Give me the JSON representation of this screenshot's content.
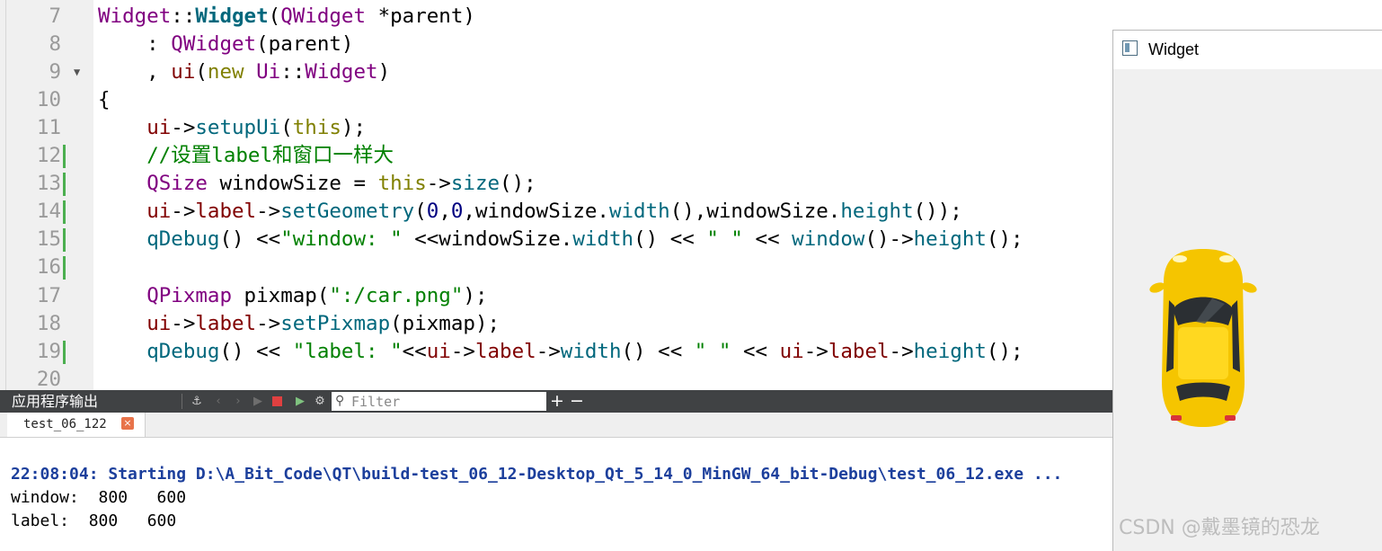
{
  "editor": {
    "lines": [
      {
        "n": "7",
        "modified": false,
        "fold": false,
        "tokens": [
          [
            "Widget",
            "cls"
          ],
          [
            "::",
            ""
          ],
          [
            "Widget",
            "fnb"
          ],
          [
            "(",
            ""
          ],
          [
            "QWidget",
            "cls"
          ],
          [
            " *parent)",
            ""
          ]
        ]
      },
      {
        "n": "8",
        "modified": false,
        "fold": false,
        "tokens": [
          [
            "    : ",
            ""
          ],
          [
            "QWidget",
            "cls"
          ],
          [
            "(parent)",
            ""
          ]
        ]
      },
      {
        "n": "9",
        "modified": false,
        "fold": true,
        "tokens": [
          [
            "    , ",
            ""
          ],
          [
            "ui",
            "mem"
          ],
          [
            "(",
            ""
          ],
          [
            "new",
            "kw"
          ],
          [
            " ",
            ""
          ],
          [
            "Ui",
            "cls"
          ],
          [
            "::",
            ""
          ],
          [
            "Widget",
            "cls"
          ],
          [
            ")",
            ""
          ]
        ]
      },
      {
        "n": "10",
        "modified": false,
        "fold": false,
        "tokens": [
          [
            "{",
            ""
          ]
        ]
      },
      {
        "n": "11",
        "modified": false,
        "fold": false,
        "tokens": [
          [
            "    ",
            ""
          ],
          [
            "ui",
            "mem"
          ],
          [
            "->",
            ""
          ],
          [
            "setupUi",
            "fn"
          ],
          [
            "(",
            ""
          ],
          [
            "this",
            "kw"
          ],
          [
            ");",
            ""
          ]
        ]
      },
      {
        "n": "12",
        "modified": true,
        "fold": false,
        "tokens": [
          [
            "    ",
            ""
          ],
          [
            "//设置label和窗口一样大",
            "cmt"
          ]
        ]
      },
      {
        "n": "13",
        "modified": true,
        "fold": false,
        "tokens": [
          [
            "    ",
            ""
          ],
          [
            "QSize",
            "cls"
          ],
          [
            " windowSize = ",
            ""
          ],
          [
            "this",
            "kw"
          ],
          [
            "->",
            ""
          ],
          [
            "size",
            "fn"
          ],
          [
            "();",
            ""
          ]
        ]
      },
      {
        "n": "14",
        "modified": true,
        "fold": false,
        "tokens": [
          [
            "    ",
            ""
          ],
          [
            "ui",
            "mem"
          ],
          [
            "->",
            ""
          ],
          [
            "label",
            "mem"
          ],
          [
            "->",
            ""
          ],
          [
            "setGeometry",
            "fn"
          ],
          [
            "(",
            ""
          ],
          [
            "0",
            "num"
          ],
          [
            ",",
            ""
          ],
          [
            "0",
            "num"
          ],
          [
            ",windowSize.",
            ""
          ],
          [
            "width",
            "fn"
          ],
          [
            "(),windowSize.",
            ""
          ],
          [
            "height",
            "fn"
          ],
          [
            "());",
            ""
          ]
        ]
      },
      {
        "n": "15",
        "modified": true,
        "fold": false,
        "tokens": [
          [
            "    ",
            ""
          ],
          [
            "qDebug",
            "fn"
          ],
          [
            "() <<",
            ""
          ],
          [
            "\"window: \"",
            "str"
          ],
          [
            " <<windowSize.",
            ""
          ],
          [
            "width",
            "fn"
          ],
          [
            "() << ",
            ""
          ],
          [
            "\" \"",
            "str"
          ],
          [
            " << ",
            ""
          ],
          [
            "window",
            "fn"
          ],
          [
            "()->",
            ""
          ],
          [
            "height",
            "fn"
          ],
          [
            "();",
            ""
          ]
        ]
      },
      {
        "n": "16",
        "modified": true,
        "fold": false,
        "tokens": []
      },
      {
        "n": "17",
        "modified": false,
        "fold": false,
        "tokens": [
          [
            "    ",
            ""
          ],
          [
            "QPixmap",
            "cls"
          ],
          [
            " pixmap(",
            ""
          ],
          [
            "\":/car.png\"",
            "str"
          ],
          [
            ");",
            ""
          ]
        ]
      },
      {
        "n": "18",
        "modified": false,
        "fold": false,
        "tokens": [
          [
            "    ",
            ""
          ],
          [
            "ui",
            "mem"
          ],
          [
            "->",
            ""
          ],
          [
            "label",
            "mem"
          ],
          [
            "->",
            ""
          ],
          [
            "setPixmap",
            "fn"
          ],
          [
            "(pixmap);",
            ""
          ]
        ]
      },
      {
        "n": "19",
        "modified": true,
        "fold": false,
        "tokens": [
          [
            "    ",
            ""
          ],
          [
            "qDebug",
            "fn"
          ],
          [
            "() << ",
            ""
          ],
          [
            "\"label: \"",
            "str"
          ],
          [
            "<<",
            ""
          ],
          [
            "ui",
            "mem"
          ],
          [
            "->",
            ""
          ],
          [
            "label",
            "mem"
          ],
          [
            "->",
            ""
          ],
          [
            "width",
            "fn"
          ],
          [
            "() << ",
            ""
          ],
          [
            "\" \"",
            "str"
          ],
          [
            " << ",
            ""
          ],
          [
            "ui",
            "mem"
          ],
          [
            "->",
            ""
          ],
          [
            "label",
            "mem"
          ],
          [
            "->",
            ""
          ],
          [
            "height",
            "fn"
          ],
          [
            "();",
            ""
          ]
        ]
      },
      {
        "n": "20",
        "modified": false,
        "fold": false,
        "tokens": []
      }
    ]
  },
  "output_pane": {
    "title": "应用程序输出",
    "filter_placeholder": "Filter",
    "plus_label": "+",
    "minus_label": "−",
    "tab_label": "test_06_122",
    "tab_close_label": "×",
    "lines": [
      "22:08:04: Starting D:\\A_Bit_Code\\QT\\build-test_06_12-Desktop_Qt_5_14_0_MinGW_64_bit-Debug\\test_06_12.exe ...",
      "window:  800   600",
      "label:  800   600"
    ]
  },
  "widget_window": {
    "title": "Widget"
  },
  "watermark": "CSDN @戴墨镜的恐龙",
  "icons": [
    "app-window-icon",
    "search-icon",
    "attach-icon",
    "prev-icon",
    "next-icon",
    "run-icon",
    "stop-icon",
    "debug-run-icon",
    "settings-icon",
    "close-icon",
    "fold-arrow-icon"
  ],
  "colors": {
    "class": "#800080",
    "function": "#00677c",
    "keyword": "#808000",
    "member": "#800000",
    "string": "#008000",
    "modified_marker": "#4caf50",
    "toolbar_bg": "#404244",
    "start_message": "#1c3f9c"
  }
}
